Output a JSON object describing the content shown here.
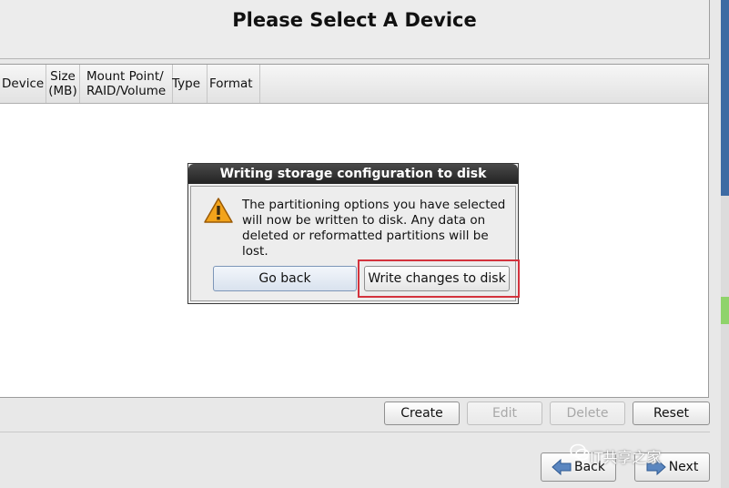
{
  "header": {
    "title": "Please Select A Device"
  },
  "table": {
    "columns": [
      {
        "line1": "Device",
        "line2": ""
      },
      {
        "line1": "Size",
        "line2": "(MB)"
      },
      {
        "line1": "Mount Point/",
        "line2": "RAID/Volume"
      },
      {
        "line1": "Type",
        "line2": ""
      },
      {
        "line1": "Format",
        "line2": ""
      }
    ]
  },
  "actions": {
    "create": "Create",
    "edit": "Edit",
    "delete": "Delete",
    "reset": "Reset"
  },
  "nav": {
    "back": "Back",
    "next": "Next"
  },
  "dialog": {
    "title": "Writing storage configuration to disk",
    "message": "The partitioning options you have selected\nwill now be written to disk.  Any data on\ndeleted or reformatted partitions will be lost.",
    "go_back": "Go back",
    "write_changes": "Write changes to disk",
    "icon": "warning-icon"
  },
  "watermark": {
    "text": "IT共享之家"
  },
  "colors": {
    "highlight": "#d3333d",
    "titlebar": "#2a2a2a",
    "accent_blue": "#3d6ba3"
  }
}
